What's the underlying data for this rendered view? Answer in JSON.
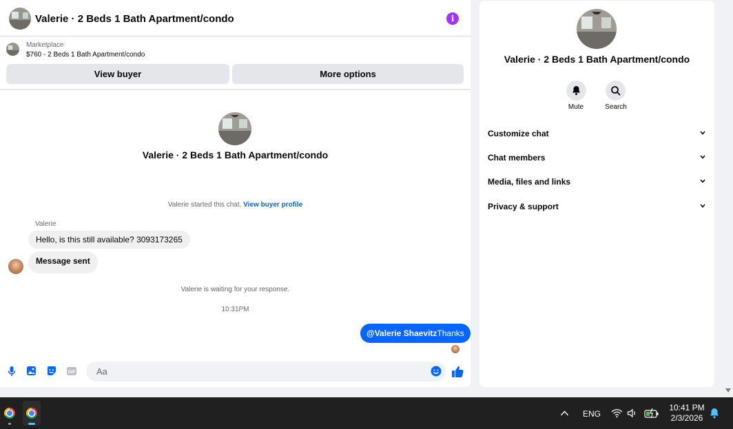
{
  "header": {
    "title": "Valerie · 2 Beds 1 Bath Apartment/condo",
    "info_icon": "info-icon"
  },
  "marketplace": {
    "label": "Marketplace",
    "listing": "$760 - 2 Beds 1 Bath Apartment/condo"
  },
  "actions": {
    "view_buyer": "View buyer",
    "more_options": "More options"
  },
  "conversation": {
    "title": "Valerie · 2 Beds 1 Bath Apartment/condo",
    "started_text": "Valerie started this chat.",
    "profile_link": "View buyer profile",
    "sender_name": "Valerie",
    "messages_in": [
      "Hello, is this still available? 3093173265",
      "Message sent"
    ],
    "waiting_text": "Valerie is waiting for your response.",
    "timestamp": "10:31PM",
    "message_out_mention": "@Valerie Shaevitz",
    "message_out_text": "Thanks"
  },
  "composer": {
    "placeholder": "Aa",
    "icons": [
      "microphone-icon",
      "image-icon",
      "sticker-icon",
      "gif-icon",
      "emoji-icon",
      "thumbs-up-icon"
    ],
    "gif_label": "GIF"
  },
  "side_panel": {
    "title": "Valerie · 2 Beds 1 Bath Apartment/condo",
    "mute_label": "Mute",
    "search_label": "Search",
    "sections": [
      "Customize chat",
      "Chat members",
      "Media, files and links",
      "Privacy & support"
    ]
  },
  "taskbar": {
    "language": "ENG",
    "time": "10:41 PM",
    "date": "2/3/2026"
  },
  "colors": {
    "accent": "#0866ff",
    "info_purple": "#a033ff",
    "link_blue": "#0064d1",
    "taskbar": "#202020"
  }
}
